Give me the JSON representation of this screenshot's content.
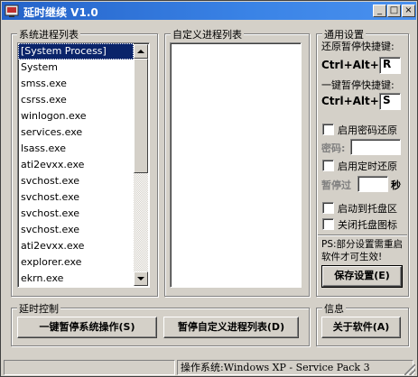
{
  "window": {
    "title": "延时继续 V1.0",
    "controls": {
      "minimize": "_",
      "restore": "□",
      "close": "×"
    }
  },
  "system_process_list": {
    "title": "系统进程列表",
    "items": [
      "[System Process]",
      "System",
      "smss.exe",
      "csrss.exe",
      "winlogon.exe",
      "services.exe",
      "lsass.exe",
      "ati2evxx.exe",
      "svchost.exe",
      "svchost.exe",
      "svchost.exe",
      "svchost.exe",
      "ati2evxx.exe",
      "explorer.exe",
      "ekrn.exe"
    ],
    "selected": "[System Process]"
  },
  "custom_process_list": {
    "title": "自定义进程列表",
    "items": []
  },
  "settings": {
    "title": "通用设置",
    "restore_hotkey_label": "还原暂停快捷键:",
    "restore_hotkey_prefix": "Ctrl+Alt+",
    "restore_hotkey_value": "R",
    "pause_hotkey_label": "一键暂停快捷键:",
    "pause_hotkey_prefix": "Ctrl+Alt+",
    "pause_hotkey_value": "S",
    "password_restore_label": "启用密码还原",
    "password_restore_checked": false,
    "password_label": "密码:",
    "password_value": "",
    "timed_restore_label": "启用定时还原",
    "timed_restore_checked": false,
    "pause_after_label": "暂停过",
    "pause_after_value": "",
    "seconds_label": "秒",
    "start_to_tray_label": "启动到托盘区",
    "start_to_tray_checked": false,
    "close_tray_icon_label": "关闭托盘图标",
    "close_tray_icon_checked": false,
    "note": "PS:部分设置需重启软件才可生效!",
    "save_button": "保存设置(E)"
  },
  "delay_control": {
    "title": "延时控制",
    "pause_system_button": "一键暂停系统操作(S)",
    "pause_custom_button": "暂停自定义进程列表(D)"
  },
  "info": {
    "title": "信息",
    "about_button": "关于软件(A)"
  },
  "statusbar": {
    "os_info": "操作系统:Windows XP - Service Pack 3"
  },
  "colors": {
    "titlebar": "#2563c9",
    "selection": "#0a246a",
    "face": "#d4d0c8"
  }
}
